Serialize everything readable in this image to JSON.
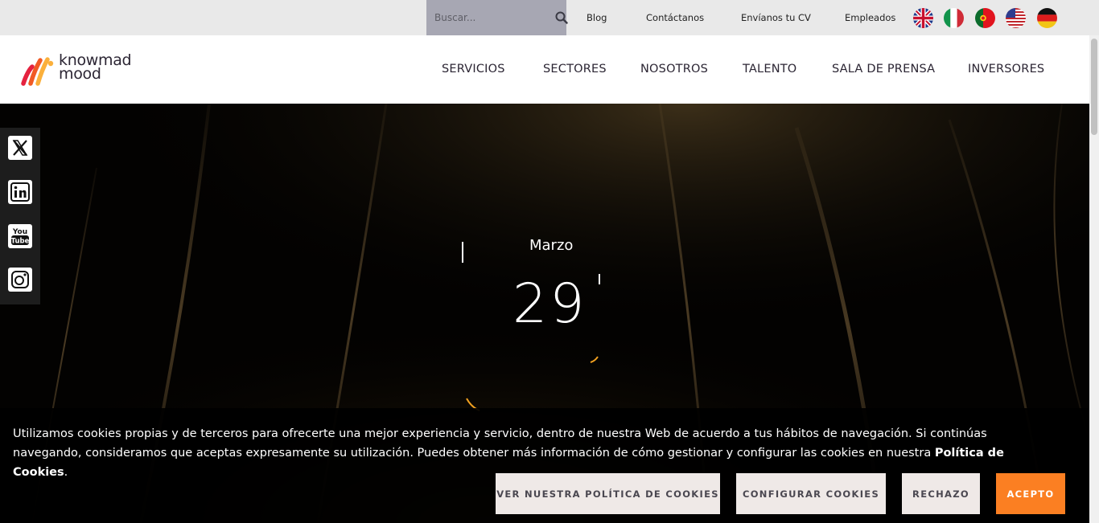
{
  "topbar": {
    "search": {
      "placeholder": "Buscar...",
      "value": ""
    },
    "links": [
      "Blog",
      "Contáctanos",
      "Envíanos tu CV",
      "Empleados"
    ],
    "flags": [
      "uk-flag-icon",
      "italy-flag-icon",
      "portugal-flag-icon",
      "usa-flag-icon",
      "germany-flag-icon"
    ]
  },
  "header": {
    "logo_line1": "knowmad",
    "logo_line2": "mood",
    "nav": [
      "SERVICIOS",
      "SECTORES",
      "NOSOTROS",
      "TALENTO",
      "SALA DE PRENSA",
      "INVERSORES"
    ]
  },
  "hero": {
    "month": "Marzo",
    "day": "29"
  },
  "social": [
    "x-twitter-icon",
    "linkedin-icon",
    "youtube-icon",
    "instagram-icon"
  ],
  "cookie": {
    "text": "Utilizamos cookies propias y de terceros para ofrecerte una mejor experiencia y servicio, dentro de nuestra Web de acuerdo a tus hábitos de navegación. Si continúas navegando, consideramos que aceptas expresamente su utilización. Puedes obtener más información de cómo gestionar y configurar las cookies en nuestra ",
    "policy_link": "Política de Cookies",
    "period": ".",
    "buttons": {
      "view_policy": "VER NUESTRA POLÍTICA DE COOKIES",
      "configure": "CONFIGURAR COOKIES",
      "reject": "RECHAZO",
      "accept": "ACEPTO"
    }
  },
  "colors": {
    "accent": "#fb7f22",
    "text_dark": "#2b2533",
    "search_bg": "#a7a7b3",
    "topbar_bg": "#e9e9e9"
  }
}
